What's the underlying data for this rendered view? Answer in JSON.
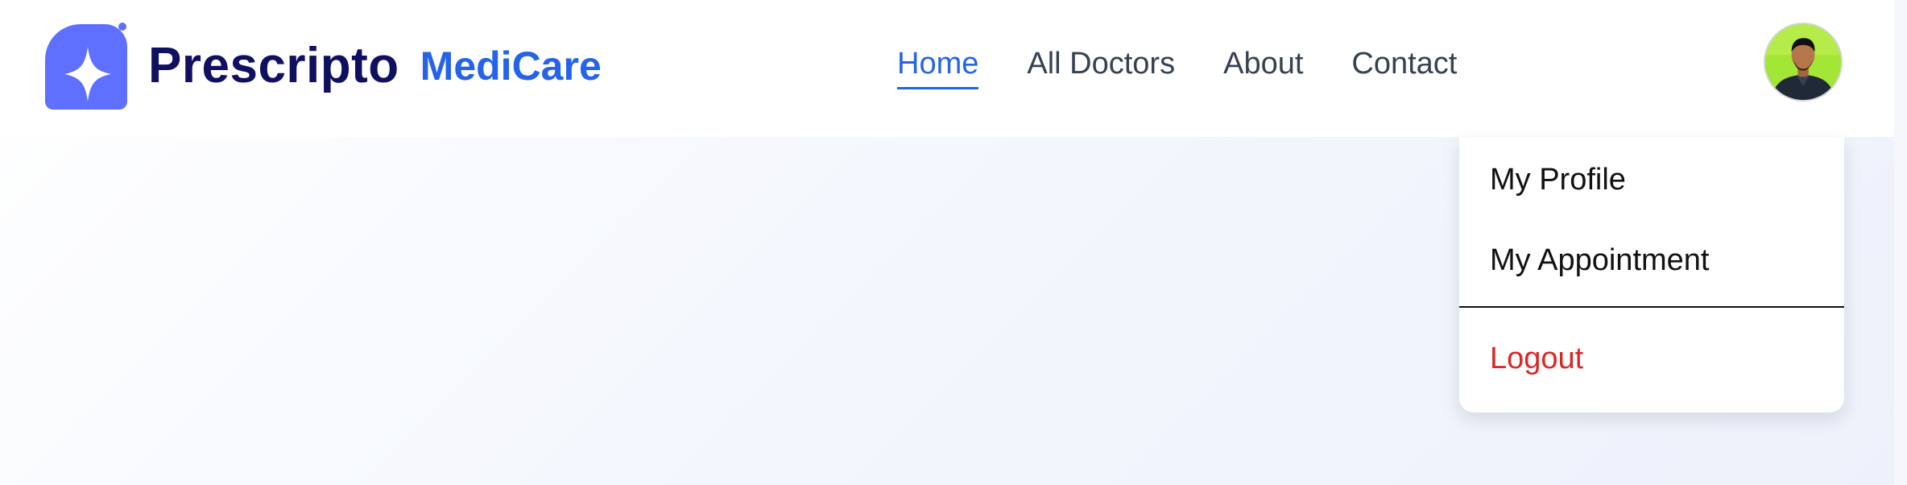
{
  "header": {
    "logo_text": "Prescripto",
    "brand_name": "MediCare",
    "logo_icon": "sparkle-card-icon",
    "nav": [
      {
        "label": "Home",
        "active": true
      },
      {
        "label": "All Doctors",
        "active": false
      },
      {
        "label": "About",
        "active": false
      },
      {
        "label": "Contact",
        "active": false
      }
    ]
  },
  "profile_menu": {
    "avatar": "user-avatar",
    "items": [
      {
        "label": "My Profile"
      },
      {
        "label": "My Appointment"
      }
    ],
    "logout_label": "Logout"
  },
  "colors": {
    "brand_blue": "#2563eb",
    "logo_purple": "#5f6fff",
    "logo_text": "#0f1060",
    "logout_red": "#dc2626"
  }
}
